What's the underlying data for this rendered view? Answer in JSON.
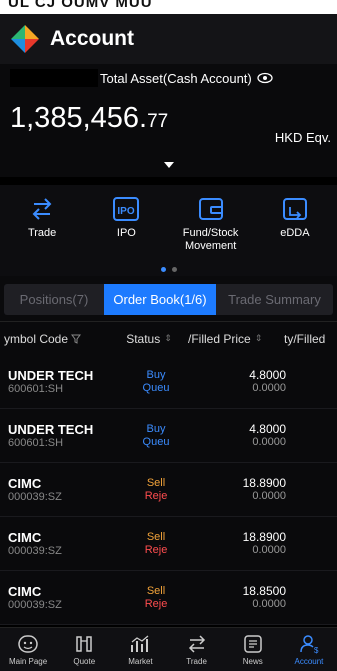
{
  "colors": {
    "accent": "#1d7bff",
    "buy": "#3b8cff",
    "sell": "#f2a33a",
    "rejected": "#ff4d4f",
    "queued": "#3b8cff"
  },
  "status_strip": {
    "cut_text": "UL CJ OUMV MUU"
  },
  "header": {
    "title": "Account",
    "logo_icon": "brand-logo-icon"
  },
  "asset": {
    "label": "Total Asset(Cash Account)",
    "amount_main": "1,385,456.",
    "amount_dec": "77",
    "currency": "HKD Eqv."
  },
  "shortcuts": [
    {
      "label": "Trade",
      "icon": "trade-arrows-icon"
    },
    {
      "label": "IPO",
      "icon": "ipo-icon"
    },
    {
      "label": "Fund/Stock\nMovement",
      "icon": "wallet-icon"
    },
    {
      "label": "eDDA",
      "icon": "edda-icon"
    }
  ],
  "tabs": [
    {
      "label": "Positions(7)"
    },
    {
      "label": "Order Book(1/6)"
    },
    {
      "label": "Trade Summary"
    }
  ],
  "columns": {
    "symbol": "ymbol Code",
    "status": "Status",
    "price": "/Filled Price",
    "qty": "ty/Filled"
  },
  "orders": [
    {
      "name": "UNDER TECH",
      "code": "600601:SH",
      "side": "Buy",
      "state": "Queu",
      "price": "4.8000",
      "filled": "0.0000"
    },
    {
      "name": "UNDER TECH",
      "code": "600601:SH",
      "side": "Buy",
      "state": "Queu",
      "price": "4.8000",
      "filled": "0.0000"
    },
    {
      "name": "CIMC",
      "code": "000039:SZ",
      "side": "Sell",
      "state": "Reje",
      "price": "18.8900",
      "filled": "0.0000"
    },
    {
      "name": "CIMC",
      "code": "000039:SZ",
      "side": "Sell",
      "state": "Reje",
      "price": "18.8900",
      "filled": "0.0000"
    },
    {
      "name": "CIMC",
      "code": "000039:SZ",
      "side": "Sell",
      "state": "Reje",
      "price": "18.8500",
      "filled": "0.0000"
    }
  ],
  "nav": [
    {
      "label": "Main Page",
      "icon": "home-icon"
    },
    {
      "label": "Quote",
      "icon": "quote-icon"
    },
    {
      "label": "Market",
      "icon": "market-icon"
    },
    {
      "label": "Trade",
      "icon": "trade-icon"
    },
    {
      "label": "News",
      "icon": "news-icon"
    },
    {
      "label": "Account",
      "icon": "account-icon"
    }
  ]
}
